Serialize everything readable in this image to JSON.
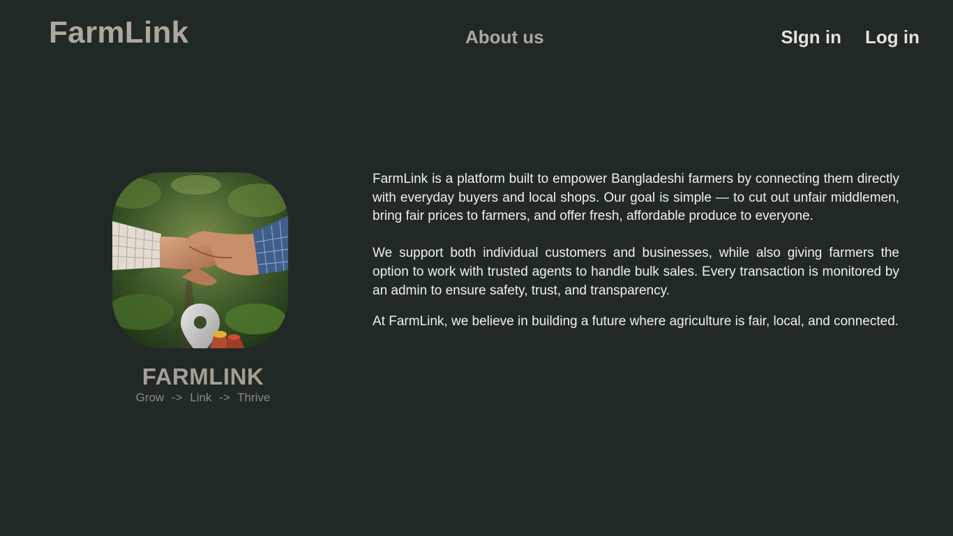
{
  "header": {
    "brand": "FarmLink",
    "about_label": "About us",
    "signin_label": "SIgn in",
    "login_label": "Log in"
  },
  "logo": {
    "title": "FARMLINK",
    "tagline": "Grow  ->  Link  ->  Thrive"
  },
  "about": {
    "paragraphs": [
      "FarmLink is a platform built to empower Bangladeshi farmers by connecting them directly with everyday buyers and local shops. Our goal is simple — to cut out unfair middlemen, bring fair prices to farmers, and offer fresh, affordable produce to everyone.",
      "We support both individual customers and businesses, while also giving farmers the option to work with trusted agents to handle bulk sales. Every transaction is monitored by an admin to ensure safety, trust, and transparency.",
      "At FarmLink, we believe in building a future where agriculture is fair, local, and connected."
    ]
  },
  "colors": {
    "background": "#202926",
    "brand": "#ada79c",
    "nav_light": "#e6e1d8",
    "body_text": "#f2efe9"
  },
  "icons": [
    "handshake-photo",
    "location-pin-icon",
    "produce-sack-icon"
  ]
}
